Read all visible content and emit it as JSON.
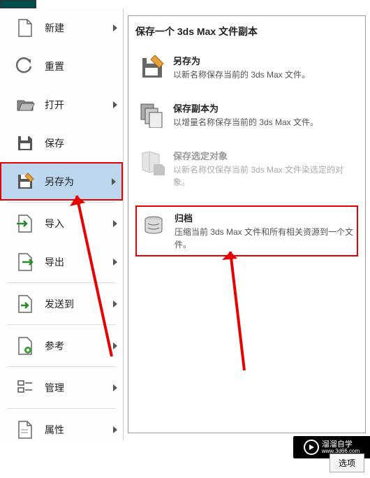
{
  "menu": {
    "new": "新建",
    "reset": "重置",
    "open": "打开",
    "save": "保存",
    "saveas": "另存为",
    "import": "导入",
    "export": "导出",
    "sendto": "发送到",
    "reference": "参考",
    "manage": "管理",
    "properties": "属性"
  },
  "panel": {
    "title": "保存一个 3ds Max 文件副本",
    "items": [
      {
        "title": "另存为",
        "desc": "以新名称保存当前的 3ds Max 文件。"
      },
      {
        "title": "保存副本为",
        "desc": "以增量名称保存当前的 3ds Max 文件。"
      },
      {
        "title": "保存选定对象",
        "desc": "以新名称仅保存当前 3ds Max 文件染选定的对象。"
      },
      {
        "title": "归档",
        "desc": "压缩当前 3ds Max 文件和所有相关资源到一个文件。"
      }
    ]
  },
  "bottom": {
    "options": "选项"
  },
  "watermark": {
    "name": "溜溜自学",
    "url": "www.3d66.com"
  }
}
